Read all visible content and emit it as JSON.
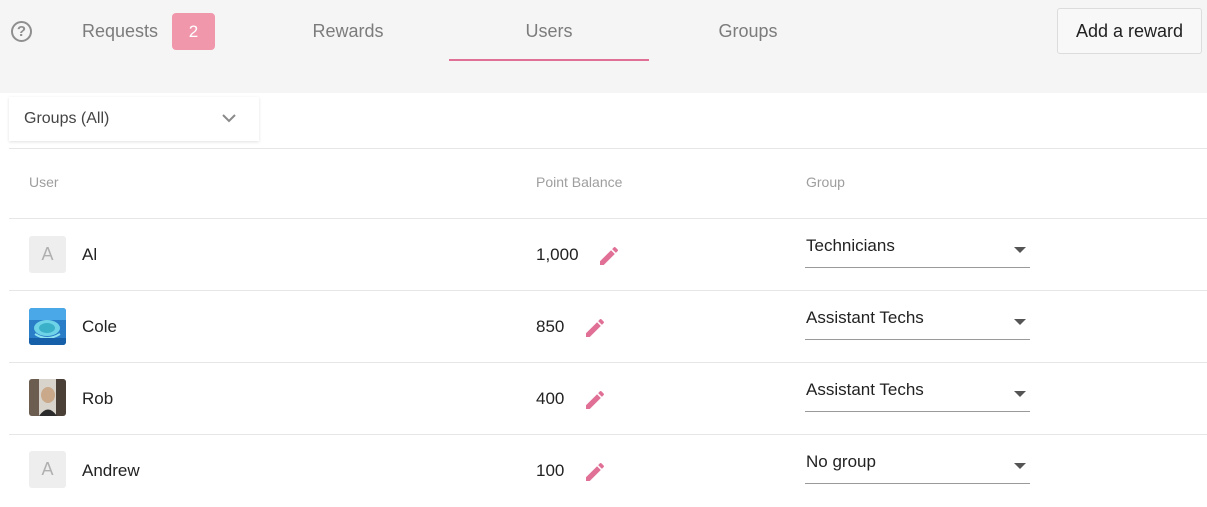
{
  "tabs": {
    "requests": {
      "label": "Requests",
      "badge": "2"
    },
    "rewards": {
      "label": "Rewards"
    },
    "users": {
      "label": "Users"
    },
    "groups": {
      "label": "Groups"
    }
  },
  "actions": {
    "add_reward_label": "Add a reward"
  },
  "filter": {
    "label": "Groups (All)"
  },
  "table": {
    "headers": {
      "user": "User",
      "points": "Point Balance",
      "group": "Group"
    },
    "rows": [
      {
        "initial": "A",
        "name": "Al",
        "points": "1,000",
        "group": "Technicians",
        "avatar": "initial"
      },
      {
        "initial": "",
        "name": "Cole",
        "points": "850",
        "group": "Assistant Techs",
        "avatar": "photo-turtle"
      },
      {
        "initial": "",
        "name": "Rob",
        "points": "400",
        "group": "Assistant Techs",
        "avatar": "photo-person"
      },
      {
        "initial": "A",
        "name": "Andrew",
        "points": "100",
        "group": "No group",
        "avatar": "initial"
      }
    ]
  },
  "colors": {
    "accent": "#e07095",
    "badge": "#f097ac",
    "topbar": "#f5f5f5"
  }
}
